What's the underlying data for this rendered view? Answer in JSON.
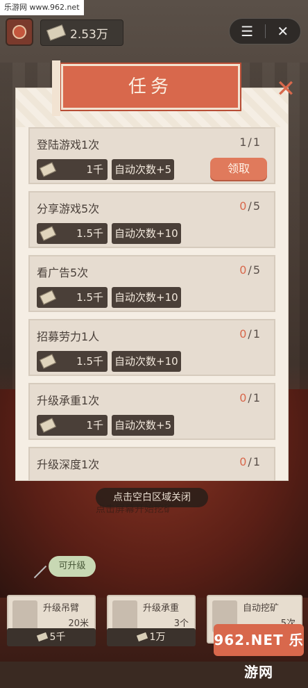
{
  "watermark": "乐游网 www.962.net",
  "currency": "2.53万",
  "modal": {
    "title": "任务",
    "tasks": [
      {
        "name": "登陆游戏1次",
        "current": "1",
        "sep": "/",
        "total": "1",
        "money": "1千",
        "auto": "自动次数+5",
        "claim": "领取"
      },
      {
        "name": "分享游戏5次",
        "current": "0",
        "sep": "/",
        "total": "5",
        "money": "1.5千",
        "auto": "自动次数+10"
      },
      {
        "name": "看广告5次",
        "current": "0",
        "sep": "/",
        "total": "5",
        "money": "1.5千",
        "auto": "自动次数+10"
      },
      {
        "name": "招募劳力1人",
        "current": "0",
        "sep": "/",
        "total": "1",
        "money": "1.5千",
        "auto": "自动次数+10"
      },
      {
        "name": "升级承重1次",
        "current": "0",
        "sep": "/",
        "total": "1",
        "money": "1千",
        "auto": "自动次数+5"
      },
      {
        "name": "升级深度1次",
        "current": "0",
        "sep": "/",
        "total": "1"
      }
    ]
  },
  "hint": "点击空白区域关闭",
  "hint_under": "点击屏幕开始挖矿",
  "upgrade_tip": "可升级",
  "cards": [
    {
      "name": "升级吊臂",
      "value": "20米",
      "cost": "5千"
    },
    {
      "name": "升级承重",
      "value": "3个",
      "cost": "1万"
    },
    {
      "name": "自动挖矿",
      "value": "5次"
    }
  ],
  "logo": "962.NET 乐游网",
  "icons": {
    "menu": "menu-icon",
    "fullscreen": "fullscreen-icon",
    "close": "close-icon",
    "money": "money-icon"
  }
}
